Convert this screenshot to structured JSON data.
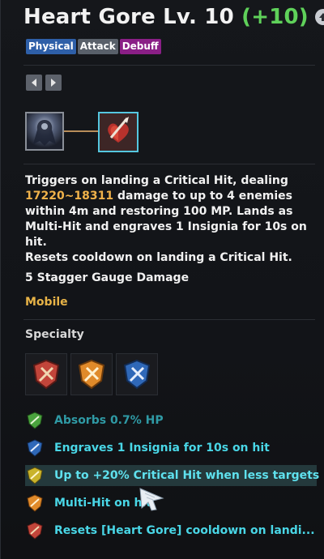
{
  "skill": {
    "name": "Heart Gore Lv. 10",
    "bonus": "(+10)"
  },
  "tags": [
    "Physical",
    "Attack",
    "Debuff"
  ],
  "description": {
    "line1": "Triggers on landing a Critical Hit, dealing",
    "damage": "17220~18311",
    "line2_rest": " damage to up to 4 enemies",
    "line3": "within 4m and restoring 100 MP. Lands as",
    "line4": "Multi-Hit and engraves 1 Insignia for 10s on hit.",
    "line5": "Resets cooldown on landing a Critical Hit."
  },
  "stagger": "5 Stagger Gauge Damage",
  "mobility": "Mobile",
  "specialty": {
    "heading": "Specialty",
    "slots": [
      {
        "icon": "red-shield-specialty-icon",
        "color": "#c2453a"
      },
      {
        "icon": "orange-shield-specialty-icon",
        "color": "#e08a2a"
      },
      {
        "icon": "blue-shield-specialty-icon",
        "color": "#2f68b8"
      }
    ]
  },
  "traits": [
    {
      "text": "Absorbs 0.7% HP",
      "icon": "green-shield-icon",
      "color": "#4aa33e",
      "state": "dim"
    },
    {
      "text": "Engraves 1 Insignia for 10s on hit",
      "icon": "blue-shield-icon",
      "color": "#2f68b8",
      "state": "normal"
    },
    {
      "text": "Up to +20% Critical Hit when less targets",
      "icon": "yellow-shield-icon",
      "color": "#c9b32a",
      "state": "highlight"
    },
    {
      "text": "Multi-Hit on hit",
      "icon": "orange-shield-icon",
      "color": "#e08a2a",
      "state": "normal"
    },
    {
      "text": "Resets [Heart Gore] cooldown on landi...",
      "icon": "red-shield-icon",
      "color": "#c2453a",
      "state": "normal"
    }
  ],
  "colors": {
    "bonus": "#5fd15a",
    "damage": "#f0b24a",
    "mobile": "#e7b347",
    "trait": "#49d6e6"
  }
}
